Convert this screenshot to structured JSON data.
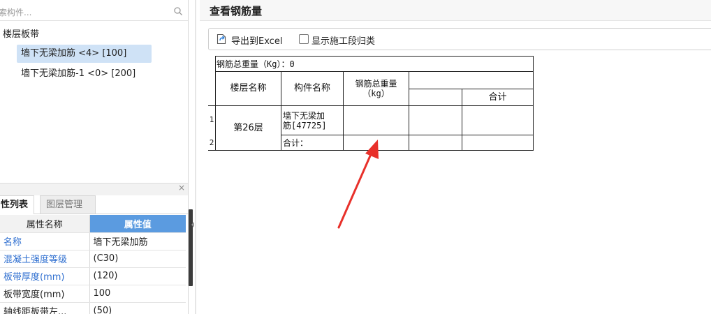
{
  "left_panel": {
    "search_placeholder": "索构件...",
    "tree": {
      "root": "楼层板带",
      "items": [
        {
          "label": "墙下无梁加筋 <4> [100]",
          "selected": true
        },
        {
          "label": "墙下无梁加筋-1 <0> [200]",
          "selected": false
        }
      ]
    },
    "close_label": "×",
    "tabs": [
      {
        "label": "性列表",
        "active": true
      },
      {
        "label": "图层管理",
        "active": false
      }
    ],
    "prop_table": {
      "header": {
        "name": "属性名称",
        "value": "属性值"
      },
      "rows": [
        {
          "name": "名称",
          "value": "墙下无梁加筋",
          "name_blue": true
        },
        {
          "name": "混凝土强度等级",
          "value": "(C30)",
          "name_blue": true
        },
        {
          "name": "板带厚度(mm)",
          "value": "(120)",
          "name_blue": true
        },
        {
          "name": "板带宽度(mm)",
          "value": "100",
          "name_blue": false
        },
        {
          "name": "轴线距板带左...",
          "value": "(50)",
          "name_blue": false
        }
      ]
    }
  },
  "dialog": {
    "title": "查看钢筋量",
    "toolbar": {
      "export_label": "导出到Excel",
      "checkbox_label": "显示施工段归类",
      "checkbox_checked": false
    },
    "table": {
      "total_weight_label": "钢筋总重量（Kg）：0",
      "headers": {
        "floor": "楼层名称",
        "component": "构件名称",
        "total": "钢筋总重量\n（kg）",
        "sum": "合计"
      },
      "row_numbers": [
        "1",
        "2"
      ],
      "floor_value": "第26层",
      "component_value": "墙下无梁加\n筋[47725]",
      "subtotal_label": "合计："
    }
  },
  "colors": {
    "selection": "#cfe2f6",
    "header_accent": "#5b9be0",
    "prop_name_blue": "#2f6fd0",
    "annotation_arrow": "#e8302a"
  }
}
